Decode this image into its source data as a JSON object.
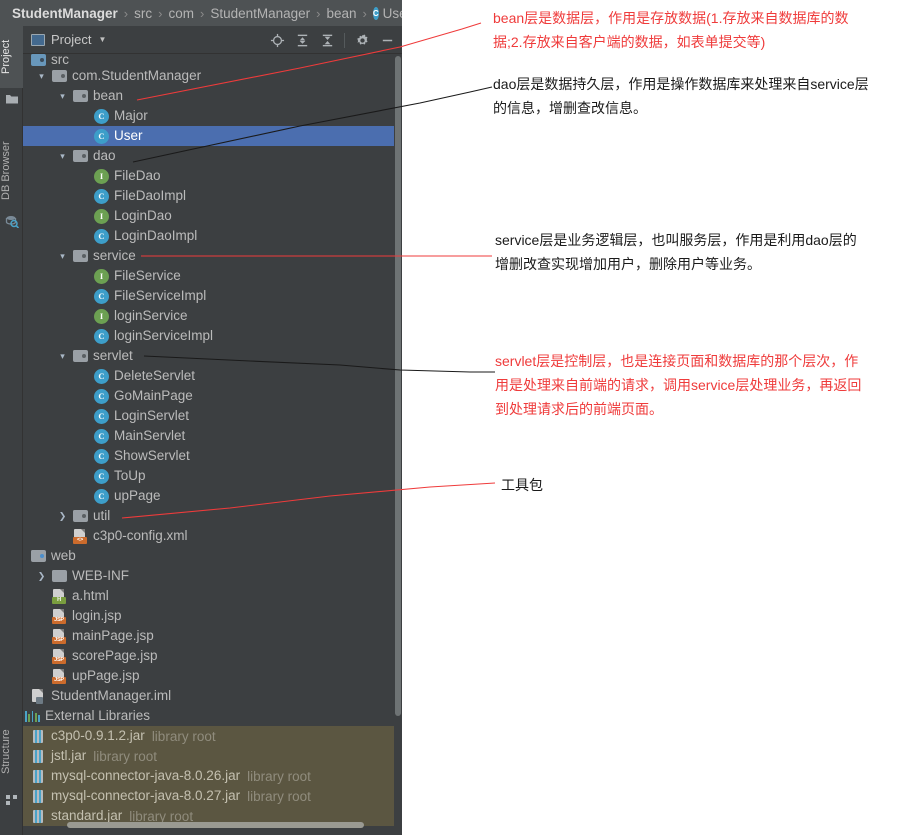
{
  "breadcrumb": {
    "items": [
      {
        "label": "StudentManager",
        "root": true,
        "icon": null
      },
      {
        "label": "src",
        "root": false,
        "icon": null
      },
      {
        "label": "com",
        "root": false,
        "icon": null
      },
      {
        "label": "StudentManager",
        "root": false,
        "icon": null
      },
      {
        "label": "bean",
        "root": false,
        "icon": null
      },
      {
        "label": "User",
        "root": false,
        "icon": "class-icon"
      }
    ],
    "separator": "›"
  },
  "toolstrip": {
    "tabs": [
      {
        "label": "Project",
        "active": true,
        "name": "tool-tab-project"
      },
      {
        "label": "DB Browser",
        "active": false,
        "name": "tool-tab-db-browser"
      },
      {
        "label": "Structure",
        "active": false,
        "name": "tool-tab-structure"
      }
    ],
    "icons": [
      "folder-icon",
      "database-search-icon",
      "structure-icon"
    ]
  },
  "toolwindow": {
    "title": "Project",
    "title_icon": "project-view-icon",
    "dropdown_icon": "chevron-down-icon",
    "actions": [
      {
        "name": "select-opened-file-button",
        "icon": "crosshair-target-icon"
      },
      {
        "name": "expand-all-button",
        "icon": "expand-all-icon"
      },
      {
        "name": "collapse-all-button",
        "icon": "collapse-all-icon"
      },
      {
        "name": "settings-button",
        "icon": "gear-icon"
      },
      {
        "name": "hide-button",
        "icon": "minimize-icon"
      }
    ]
  },
  "tree": {
    "rows": [
      {
        "label": "src",
        "indent": 0,
        "icon": "folder-src",
        "arrow": "down",
        "clipped": true
      },
      {
        "label": "com.StudentManager",
        "indent": 1,
        "icon": "folder-pkg",
        "arrow": "down"
      },
      {
        "label": "bean",
        "indent": 2,
        "icon": "folder-pkg",
        "arrow": "down"
      },
      {
        "label": "Major",
        "indent": 3,
        "icon": "class"
      },
      {
        "label": "User",
        "indent": 3,
        "icon": "class",
        "selected": true
      },
      {
        "label": "dao",
        "indent": 2,
        "icon": "folder-pkg",
        "arrow": "down"
      },
      {
        "label": "FileDao",
        "indent": 3,
        "icon": "interface"
      },
      {
        "label": "FileDaoImpl",
        "indent": 3,
        "icon": "class"
      },
      {
        "label": "LoginDao",
        "indent": 3,
        "icon": "interface"
      },
      {
        "label": "LoginDaoImpl",
        "indent": 3,
        "icon": "class"
      },
      {
        "label": "service",
        "indent": 2,
        "icon": "folder-pkg",
        "arrow": "down"
      },
      {
        "label": "FileService",
        "indent": 3,
        "icon": "interface"
      },
      {
        "label": "FileServiceImpl",
        "indent": 3,
        "icon": "class"
      },
      {
        "label": "loginService",
        "indent": 3,
        "icon": "interface"
      },
      {
        "label": "loginServiceImpl",
        "indent": 3,
        "icon": "class"
      },
      {
        "label": "servlet",
        "indent": 2,
        "icon": "folder-pkg",
        "arrow": "down"
      },
      {
        "label": "DeleteServlet",
        "indent": 3,
        "icon": "class"
      },
      {
        "label": "GoMainPage",
        "indent": 3,
        "icon": "class"
      },
      {
        "label": "LoginServlet",
        "indent": 3,
        "icon": "class"
      },
      {
        "label": "MainServlet",
        "indent": 3,
        "icon": "class"
      },
      {
        "label": "ShowServlet",
        "indent": 3,
        "icon": "class"
      },
      {
        "label": "ToUp",
        "indent": 3,
        "icon": "class"
      },
      {
        "label": "upPage",
        "indent": 3,
        "icon": "class"
      },
      {
        "label": "util",
        "indent": 2,
        "icon": "folder-pkg",
        "arrow": "right"
      },
      {
        "label": "c3p0-config.xml",
        "indent": 2,
        "icon": "file-xml"
      },
      {
        "label": "web",
        "indent": 0,
        "icon": "folder-web",
        "arrow": "down"
      },
      {
        "label": "WEB-INF",
        "indent": 1,
        "icon": "folder-plain",
        "arrow": "right"
      },
      {
        "label": "a.html",
        "indent": 1,
        "icon": "file-html"
      },
      {
        "label": "login.jsp",
        "indent": 1,
        "icon": "file-jsp"
      },
      {
        "label": "mainPage.jsp",
        "indent": 1,
        "icon": "file-jsp"
      },
      {
        "label": "scorePage.jsp",
        "indent": 1,
        "icon": "file-jsp"
      },
      {
        "label": "upPage.jsp",
        "indent": 1,
        "icon": "file-jsp"
      },
      {
        "label": "StudentManager.iml",
        "indent": 0,
        "icon": "file-iml"
      },
      {
        "label": "External Libraries",
        "indent": -1,
        "icon": "ext-libs"
      },
      {
        "label": "c3p0-0.9.1.2.jar",
        "sub": "library root",
        "indent": 0,
        "icon": "jar",
        "arrow": "right",
        "libhl": true
      },
      {
        "label": "jstl.jar",
        "sub": "library root",
        "indent": 0,
        "icon": "jar",
        "arrow": "right",
        "libhl": true
      },
      {
        "label": "mysql-connector-java-8.0.26.jar",
        "sub": "library root",
        "indent": 0,
        "icon": "jar",
        "arrow": "right",
        "libhl": true
      },
      {
        "label": "mysql-connector-java-8.0.27.jar",
        "sub": "library root",
        "indent": 0,
        "icon": "jar",
        "arrow": "right",
        "libhl": true
      },
      {
        "label": "standard.jar",
        "sub": "library root",
        "indent": 0,
        "icon": "jar",
        "arrow": "right",
        "libhl": true
      }
    ]
  },
  "annotations": [
    {
      "name": "annotation-bean",
      "color": "red",
      "lines": [
        "bean层是数据层，作用是存放数据(1.存放来自数据库的数",
        "据;2.存放来自客户端的数据，如表单提交等)"
      ]
    },
    {
      "name": "annotation-dao",
      "color": "black",
      "lines": [
        "dao层是数据持久层，作用是操作数据库来处理来自service层",
        "的信息，增删查改信息。"
      ]
    },
    {
      "name": "annotation-service",
      "color": "black",
      "lines": [
        "service层是业务逻辑层，也叫服务层，作用是利用dao层的",
        "增删改查实现增加用户，删除用户等业务。"
      ]
    },
    {
      "name": "annotation-servlet",
      "color": "red",
      "lines": [
        "servlet层是控制层，也是连接页面和数据库的那个层次，作",
        "用是处理来自前端的请求，调用service层处理业务，再返回",
        "到处理请求后的前端页面。"
      ]
    },
    {
      "name": "annotation-util",
      "color": "black",
      "lines": [
        "工具包"
      ]
    }
  ],
  "colors": {
    "selection_blue": "#4b6eaf",
    "library_highlight": "#5b5641",
    "class_icon": "#3d9ec9",
    "interface_icon": "#6ca052",
    "annotation_red": "#ef3b3b",
    "annotation_black": "#1a1a1a",
    "ide_background": "#3c3f41"
  }
}
